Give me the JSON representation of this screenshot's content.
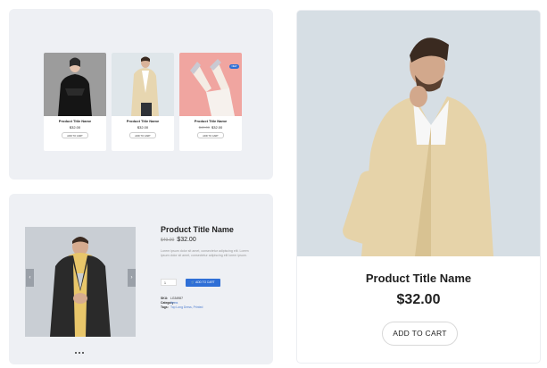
{
  "grid_panel": {
    "cards": [
      {
        "title": "Product Title Name",
        "price": "$32.00",
        "old_price": "",
        "button": "ADD TO CART",
        "badge": ""
      },
      {
        "title": "Product Title Name",
        "price": "$32.00",
        "old_price": "",
        "button": "ADD TO CART",
        "badge": ""
      },
      {
        "title": "Product Title Name",
        "price": "$32.00",
        "old_price": "$49.00",
        "button": "ADD TO CART",
        "badge": "NEW"
      }
    ]
  },
  "detail_panel": {
    "title": "Product Title Name",
    "old_price": "$49.00",
    "price": "$32.00",
    "description": "Lorem ipsum dolor sit amet, consectetur adipiscing elit. Lorem ipsum dolor sit amet, consectetur adipiscing elit lorem ipsum.",
    "quantity": "1",
    "cart_button": "ADD TO CART",
    "meta": {
      "sku_label": "SKU:",
      "sku_value": "LG34987",
      "category_label": "Category:",
      "category_value": "Items",
      "tags_label": "Tags:",
      "tags_value": "Top Long Dress, Printed"
    }
  },
  "large_card": {
    "title": "Product Title Name",
    "price": "$32.00",
    "button": "ADD TO CART"
  },
  "colors": {
    "accent": "#2f6fd6",
    "panel_bg": "#eef0f4"
  }
}
